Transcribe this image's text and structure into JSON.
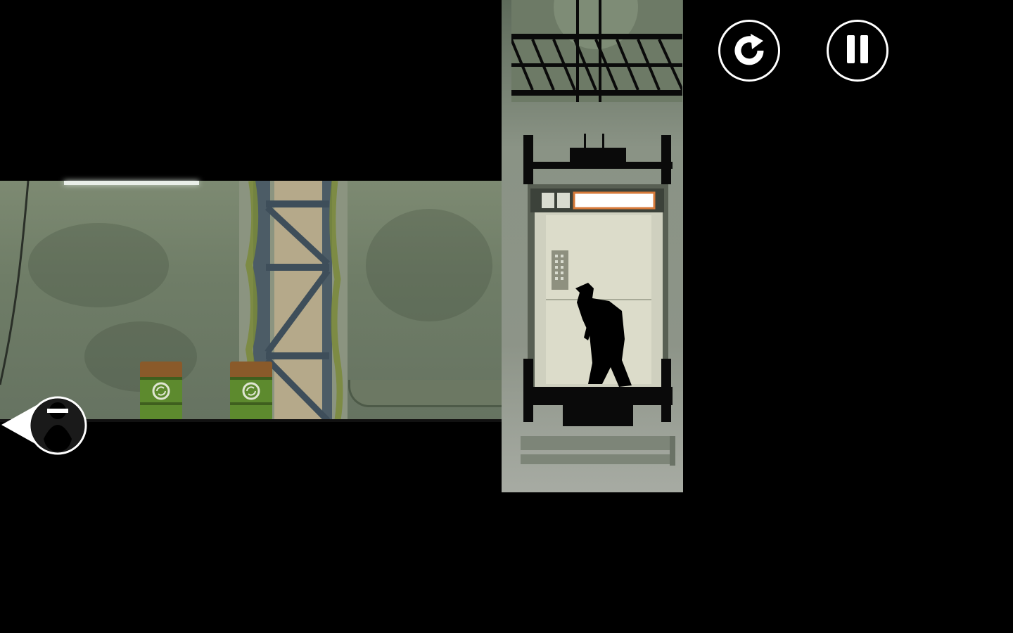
{
  "game": {
    "hud": {
      "restart_icon": "restart-icon",
      "pause_icon": "pause-icon",
      "hide_icon": "hide-character-icon"
    },
    "colors": {
      "wall": "#6f7d67",
      "shaft": "#8d9488",
      "elevator_cabin": "#d5d7c6",
      "barrel": "#5d8a2e",
      "hud_stroke": "#ffffff",
      "silhouette": "#000000"
    },
    "elevator_status_indicator": "empty"
  }
}
